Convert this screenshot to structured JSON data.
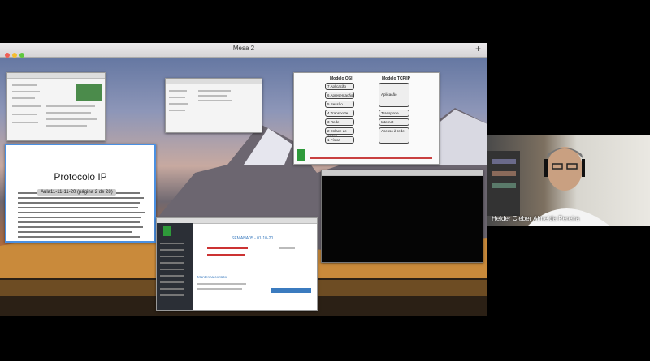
{
  "window": {
    "title": "Mesa 2"
  },
  "osi_model": {
    "title_left": "Modelo OSI",
    "title_right": "Modelo TCP/IP",
    "osi_layers": [
      "7 Aplicação",
      "6 Apresentação",
      "5 Sessão",
      "4 Transporte",
      "3 Rede",
      "2 Enlace de dados",
      "1 Física"
    ],
    "tcp_layers": [
      "Aplicação",
      "Transporte",
      "Internet",
      "Acesso à rede"
    ]
  },
  "document": {
    "heading": "Protocolo IP",
    "page_indicator": "Aula11-11-11-20 (página 2 de 28)"
  },
  "moodle": {
    "week_label": "SEMANA05 - 01-10-20",
    "contact_label": "Mantenha contato"
  },
  "participant": {
    "name": "Helder Cleber Almeida Pereira"
  }
}
